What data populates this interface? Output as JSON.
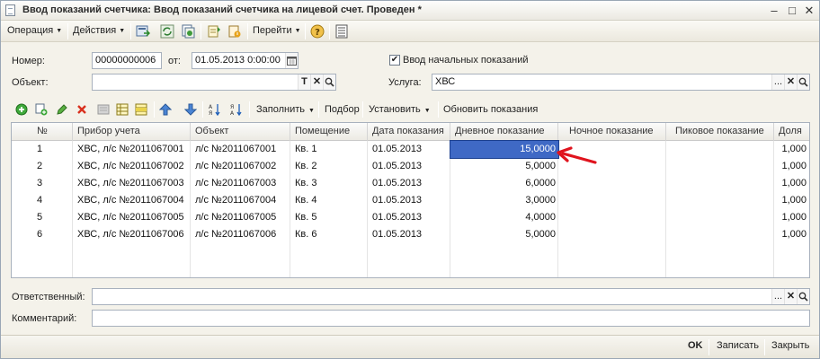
{
  "window": {
    "title": "Ввод показаний счетчика: Ввод показаний счетчика на лицевой счет. Проведен *",
    "controls": [
      "–",
      "□",
      "✕"
    ]
  },
  "toolbar": {
    "operation": "Операция",
    "actions": "Действия",
    "goto": "Перейти"
  },
  "form": {
    "number_label": "Номер:",
    "number_value": "00000000006",
    "from_label": "от:",
    "date_value": "01.05.2013  0:00:00",
    "initial_readings_checked": true,
    "initial_readings_label": "Ввод начальных показаний",
    "object_label": "Объект:",
    "object_value": "",
    "service_label": "Услуга:",
    "service_value": "ХВС",
    "field_buttons": {
      "text": "T",
      "clear": "✕",
      "search": "Q",
      "choose": "..."
    }
  },
  "grid_toolbar": {
    "fill": "Заполнить",
    "selection": "Подбор",
    "set": "Установить",
    "update_readings": "Обновить показания"
  },
  "table": {
    "columns": [
      "№",
      "Прибор учета",
      "Объект",
      "Помещение",
      "Дата показания",
      "Дневное показание",
      "Ночное показание",
      "Пиковое показание",
      "Доля"
    ],
    "rows": [
      {
        "n": "1",
        "device": "ХВС, л/с №2011067001",
        "object": "л/с №2011067001",
        "room": "Кв. 1",
        "date": "01.05.2013",
        "day": "15,0000",
        "night": "",
        "peak": "",
        "share": "1,000"
      },
      {
        "n": "2",
        "device": "ХВС, л/с №2011067002",
        "object": "л/с №2011067002",
        "room": "Кв. 2",
        "date": "01.05.2013",
        "day": "5,0000",
        "night": "",
        "peak": "",
        "share": "1,000"
      },
      {
        "n": "3",
        "device": "ХВС, л/с №2011067003",
        "object": "л/с №2011067003",
        "room": "Кв. 3",
        "date": "01.05.2013",
        "day": "6,0000",
        "night": "",
        "peak": "",
        "share": "1,000"
      },
      {
        "n": "4",
        "device": "ХВС, л/с №2011067004",
        "object": "л/с №2011067004",
        "room": "Кв. 4",
        "date": "01.05.2013",
        "day": "3,0000",
        "night": "",
        "peak": "",
        "share": "1,000"
      },
      {
        "n": "5",
        "device": "ХВС, л/с №2011067005",
        "object": "л/с №2011067005",
        "room": "Кв. 5",
        "date": "01.05.2013",
        "day": "4,0000",
        "night": "",
        "peak": "",
        "share": "1,000"
      },
      {
        "n": "6",
        "device": "ХВС, л/с №2011067006",
        "object": "л/с №2011067006",
        "room": "Кв. 6",
        "date": "01.05.2013",
        "day": "5,0000",
        "night": "",
        "peak": "",
        "share": "1,000"
      }
    ]
  },
  "bottom": {
    "responsible_label": "Ответственный:",
    "responsible_value": "",
    "comment_label": "Комментарий:",
    "comment_value": ""
  },
  "footer": {
    "ok": "OK",
    "save": "Записать",
    "close": "Закрыть"
  },
  "colors": {
    "selection": "#3f69c5",
    "annotation_arrow": "#e0141e"
  }
}
